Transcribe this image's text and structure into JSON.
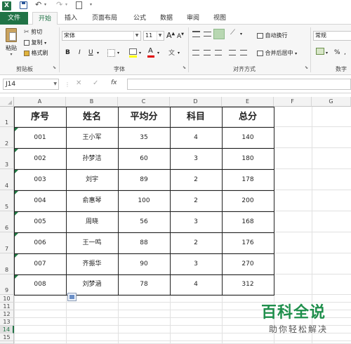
{
  "tabs": [
    "文件",
    "开始",
    "插入",
    "页面布局",
    "公式",
    "数据",
    "审阅",
    "视图"
  ],
  "ribbon": {
    "clipboard": {
      "paste": "粘贴",
      "cut": "剪切",
      "copy": "复制",
      "format_painter": "格式刷",
      "label": "剪贴板"
    },
    "font": {
      "name": "宋体",
      "size": "11",
      "label": "字体",
      "bold": "B",
      "italic": "I",
      "underline": "U",
      "grow": "A",
      "shrink": "A"
    },
    "alignment": {
      "wrap": "自动换行",
      "merge": "合并后居中",
      "label": "对齐方式"
    },
    "number": {
      "format": "常规",
      "percent": "%",
      "label": "数字"
    }
  },
  "formula_bar": {
    "name_box": "J14",
    "fx": "fx",
    "value": ""
  },
  "columns": [
    "A",
    "B",
    "C",
    "D",
    "E",
    "F",
    "G"
  ],
  "rows": [
    "1",
    "2",
    "3",
    "4",
    "5",
    "6",
    "7",
    "8",
    "9",
    "10",
    "11",
    "12",
    "13",
    "14",
    "15"
  ],
  "table": {
    "headers": [
      "序号",
      "姓名",
      "平均分",
      "科目",
      "总分"
    ],
    "rows": [
      [
        "001",
        "王小军",
        "35",
        "4",
        "140"
      ],
      [
        "002",
        "孙梦洁",
        "60",
        "3",
        "180"
      ],
      [
        "003",
        "刘宇",
        "89",
        "2",
        "178"
      ],
      [
        "004",
        "俞惠琴",
        "100",
        "2",
        "200"
      ],
      [
        "005",
        "周晓",
        "56",
        "3",
        "168"
      ],
      [
        "006",
        "王一鸣",
        "88",
        "2",
        "176"
      ],
      [
        "007",
        "齐振华",
        "90",
        "3",
        "270"
      ],
      [
        "008",
        "刘梦涵",
        "78",
        "4",
        "312"
      ]
    ]
  },
  "watermark": {
    "title": "百科全说",
    "subtitle": "助你轻松解决"
  },
  "colors": {
    "excel_green": "#217346",
    "tab_active": "#217346",
    "grid": "#e1e1e1"
  }
}
